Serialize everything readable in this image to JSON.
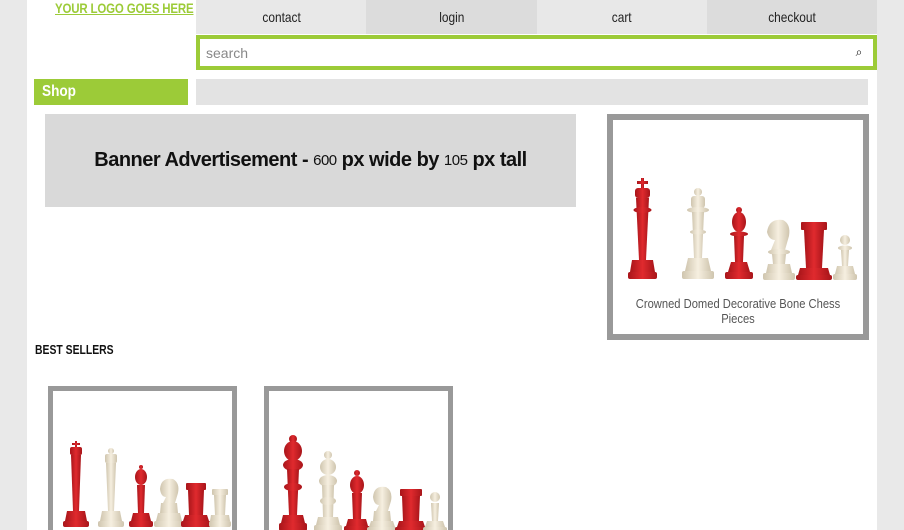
{
  "header": {
    "logo_text": "YOUR LOGO GOES HERE",
    "nav": [
      {
        "label": "contact"
      },
      {
        "label": "login"
      },
      {
        "label": "cart"
      },
      {
        "label": "checkout"
      }
    ],
    "search": {
      "placeholder": "search",
      "value": ""
    }
  },
  "shop": {
    "label": "Shop"
  },
  "banner": {
    "prefix": "Banner Advertisement -",
    "width_value": "600",
    "px_wide_by": "px wide by",
    "height_value": "105",
    "px_tall": "px tall"
  },
  "featured": {
    "caption": "Crowned Domed Decorative Bone Chess Pieces"
  },
  "best_sellers": {
    "label": "BEST SELLERS"
  },
  "colors": {
    "accent": "#9ccb38",
    "piece_red": "#d61f24",
    "piece_bone": "#efe6d2",
    "frame_gray": "#999999"
  }
}
